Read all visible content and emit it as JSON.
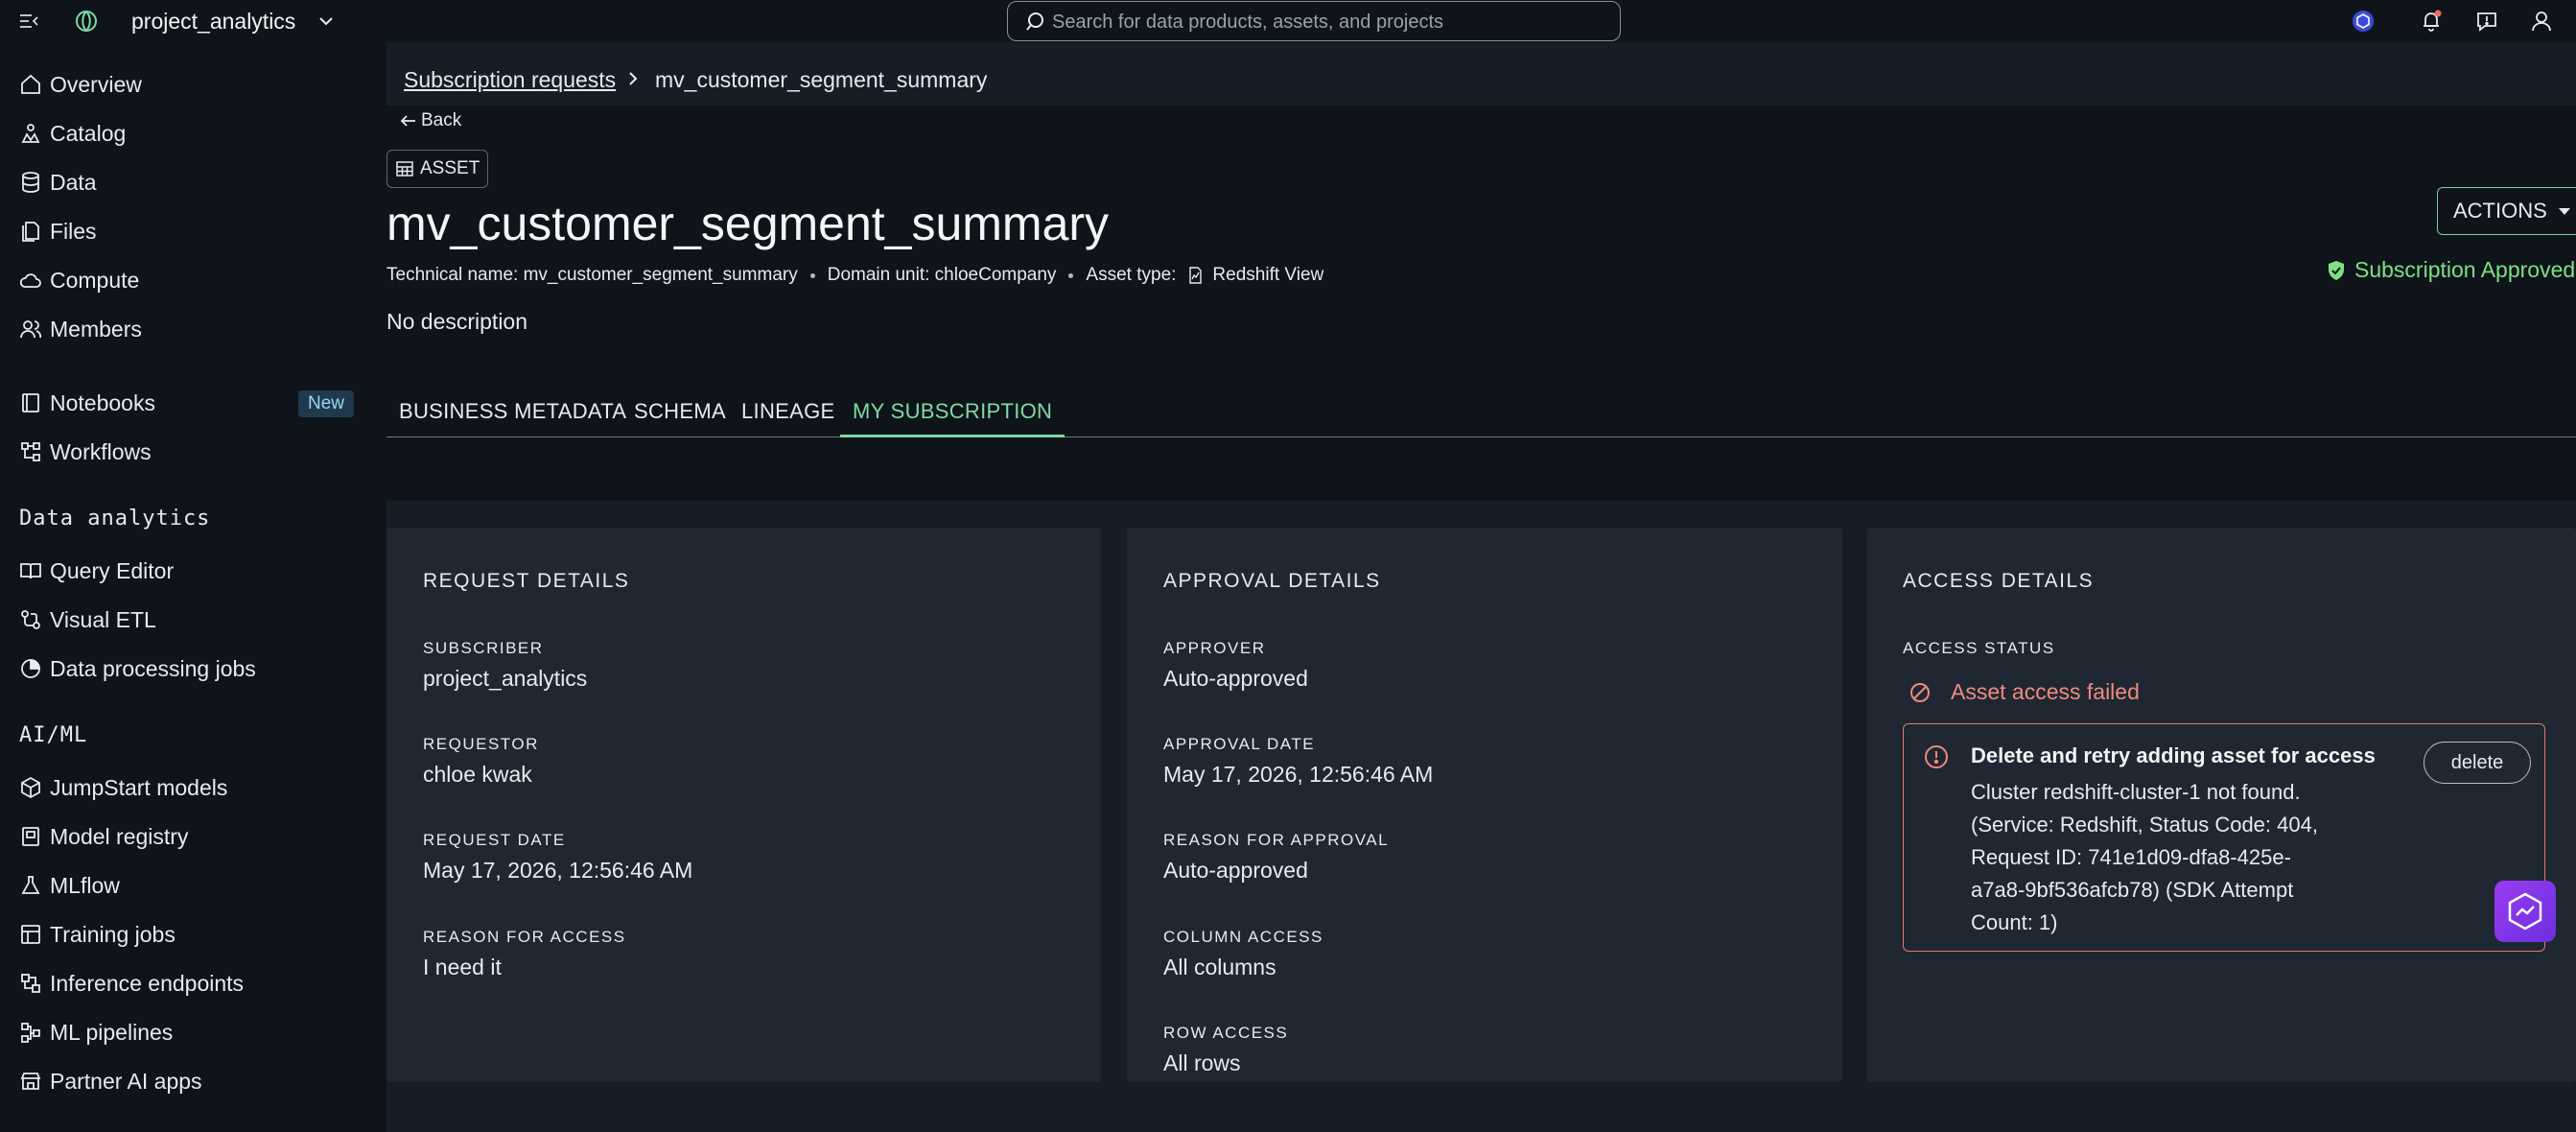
{
  "topbar": {
    "project_name": "project_analytics",
    "search_placeholder": "Search for data products, assets, and projects"
  },
  "sidebar": {
    "items": [
      {
        "label": "Overview",
        "icon": "home-icon"
      },
      {
        "label": "Catalog",
        "icon": "catalog-icon"
      },
      {
        "label": "Data",
        "icon": "database-icon"
      },
      {
        "label": "Files",
        "icon": "files-icon"
      },
      {
        "label": "Compute",
        "icon": "cloud-icon"
      },
      {
        "label": "Members",
        "icon": "members-icon"
      },
      {
        "label": "Notebooks",
        "icon": "notebook-icon",
        "badge": "New"
      },
      {
        "label": "Workflows",
        "icon": "workflow-icon"
      },
      {
        "label": "Query Editor",
        "icon": "book-icon"
      },
      {
        "label": "Visual ETL",
        "icon": "etl-icon"
      },
      {
        "label": "Data processing jobs",
        "icon": "processing-icon"
      },
      {
        "label": "JumpStart models",
        "icon": "cube-icon"
      },
      {
        "label": "Model registry",
        "icon": "registry-icon"
      },
      {
        "label": "MLflow",
        "icon": "flask-icon"
      },
      {
        "label": "Training jobs",
        "icon": "training-icon"
      },
      {
        "label": "Inference endpoints",
        "icon": "inference-icon"
      },
      {
        "label": "ML pipelines",
        "icon": "pipeline-icon"
      },
      {
        "label": "Partner AI apps",
        "icon": "store-icon"
      }
    ],
    "sections": {
      "data_analytics": "Data analytics",
      "ai_ml": "AI/ML"
    }
  },
  "breadcrumb": {
    "parent": "Subscription requests",
    "current": "mv_customer_segment_summary"
  },
  "header": {
    "back_label": "Back",
    "asset_tag": "ASSET",
    "title": "mv_customer_segment_summary",
    "technical_name": "Technical name: mv_customer_segment_summary",
    "domain_unit": "Domain unit: chloeCompany",
    "asset_type_label": "Asset type:",
    "asset_type_value": "Redshift View",
    "description": "No description",
    "actions_label": "ACTIONS",
    "subscription_status": "Subscription Approved",
    "status_color": "#7ee081"
  },
  "tabs": [
    {
      "label": "BUSINESS METADATA"
    },
    {
      "label": "SCHEMA"
    },
    {
      "label": "LINEAGE"
    },
    {
      "label": "MY SUBSCRIPTION",
      "active": true
    }
  ],
  "request_details": {
    "title": "REQUEST DETAILS",
    "subscriber_label": "SUBSCRIBER",
    "subscriber": "project_analytics",
    "requestor_label": "REQUESTOR",
    "requestor": "chloe kwak",
    "request_date_label": "REQUEST DATE",
    "request_date": "May 17, 2026, 12:56:46 AM",
    "reason_label": "REASON FOR ACCESS",
    "reason": "I need it"
  },
  "approval_details": {
    "title": "APPROVAL DETAILS",
    "approver_label": "APPROVER",
    "approver": "Auto-approved",
    "approval_date_label": "APPROVAL DATE",
    "approval_date": "May 17, 2026, 12:56:46 AM",
    "reason_label": "REASON FOR APPROVAL",
    "reason": "Auto-approved",
    "column_access_label": "COLUMN ACCESS",
    "column_access": "All columns",
    "row_access_label": "ROW ACCESS",
    "row_access": "All rows"
  },
  "access_details": {
    "title": "ACCESS DETAILS",
    "status_label": "ACCESS STATUS",
    "status": "Asset access failed",
    "error_title": "Delete and retry adding asset for access",
    "error_message": "Cluster redshift-cluster-1 not found. (Service: Redshift, Status Code: 404, Request ID: 741e1d09-dfa8-425e-a7a8-9bf536afcb78) (SDK Attempt Count: 1)",
    "delete_label": "delete",
    "error_color": "#f08a7e"
  }
}
